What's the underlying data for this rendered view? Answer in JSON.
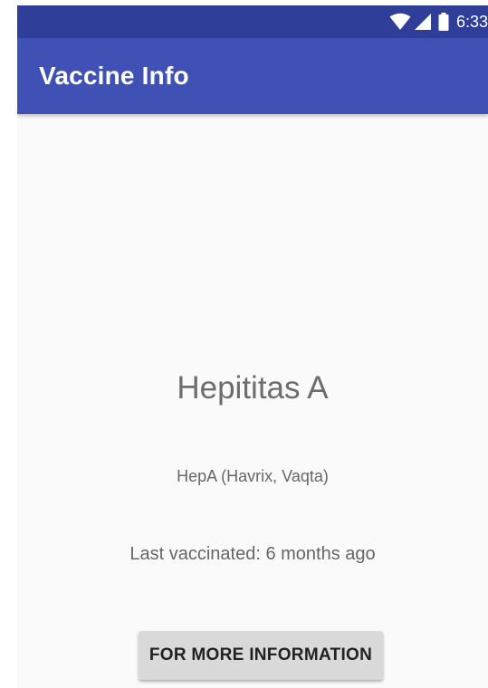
{
  "status_bar": {
    "time": "6:33",
    "icons": [
      "wifi-icon",
      "cell-signal-icon",
      "battery-icon"
    ],
    "background_color": "#2f3f99"
  },
  "app_bar": {
    "title": "Vaccine Info",
    "background_color": "#3f51b5"
  },
  "vaccine": {
    "name": "Hepititas A",
    "brands": "HepA (Havrix, Vaqta)",
    "last_vaccinated": "Last vaccinated: 6 months ago"
  },
  "actions": {
    "more_info_label": "FOR MORE INFORMATION"
  }
}
